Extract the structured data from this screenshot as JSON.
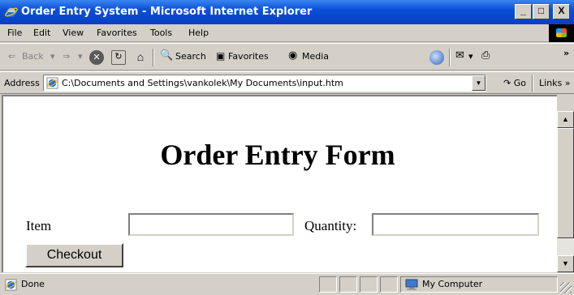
{
  "window": {
    "title": "Order Entry System - Microsoft Internet Explorer",
    "minimize": "_",
    "maximize": "□",
    "close": "X"
  },
  "menu": {
    "file": "File",
    "edit": "Edit",
    "view": "View",
    "favorites": "Favorites",
    "tools": "Tools",
    "help": "Help"
  },
  "toolbar": {
    "back": "Back",
    "search": "Search",
    "favorites": "Favorites",
    "media": "Media",
    "more": "»"
  },
  "address": {
    "label": "Address",
    "url": "C:\\Documents and Settings\\vankolek\\My Documents\\input.htm",
    "go": "Go",
    "links": "Links »"
  },
  "page": {
    "heading": "Order Entry Form",
    "item_label": "Item",
    "item_value": "",
    "quantity_label": "Quantity:",
    "quantity_value": "",
    "checkout_label": "Checkout"
  },
  "status": {
    "text": "Done",
    "zone": "My Computer"
  },
  "colors": {
    "titlebar": "#0a4fd8",
    "chrome": "#d4d0c8"
  }
}
